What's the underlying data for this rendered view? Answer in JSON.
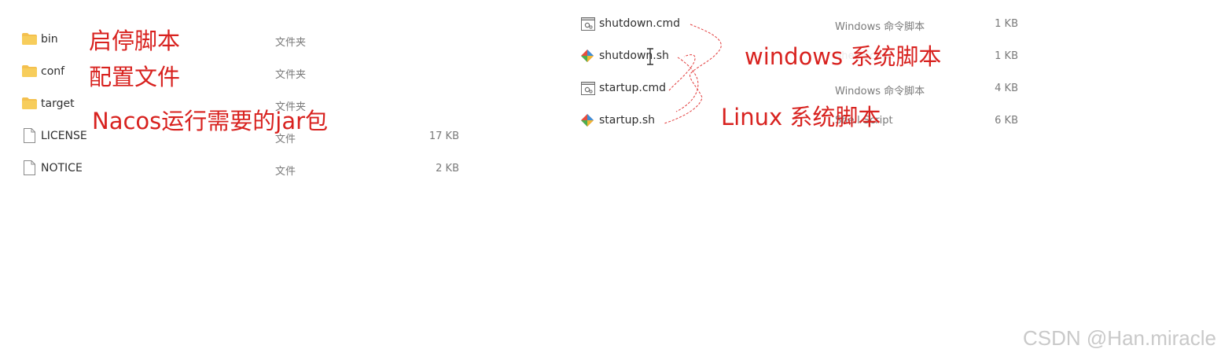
{
  "left_panel": {
    "files": [
      {
        "name": "bin",
        "type": "文件夹",
        "size": "",
        "icon": "folder-icon"
      },
      {
        "name": "conf",
        "type": "文件夹",
        "size": "",
        "icon": "folder-icon"
      },
      {
        "name": "target",
        "type": "文件夹",
        "size": "",
        "icon": "folder-icon"
      },
      {
        "name": "LICENSE",
        "type": "文件",
        "size": "17 KB",
        "icon": "file-icon"
      },
      {
        "name": "NOTICE",
        "type": "文件",
        "size": "2 KB",
        "icon": "file-icon"
      }
    ]
  },
  "right_panel": {
    "files": [
      {
        "name": "shutdown.cmd",
        "type": "Windows 命令脚本",
        "size": "1 KB",
        "icon": "cmd-script-icon"
      },
      {
        "name": "shutdown.sh",
        "type": "Shell Script",
        "size": "1 KB",
        "icon": "shell-script-icon"
      },
      {
        "name": "startup.cmd",
        "type": "Windows 命令脚本",
        "size": "4 KB",
        "icon": "cmd-script-icon"
      },
      {
        "name": "startup.sh",
        "type": "Shell Script",
        "size": "6 KB",
        "icon": "shell-script-icon"
      }
    ]
  },
  "annotations": {
    "bin": "启停脚本",
    "conf": "配置文件",
    "target": "Nacos运行需要的jar包",
    "windows": "windows 系统脚本",
    "linux": "Linux 系统脚本"
  },
  "colors": {
    "annotation": "#d8221f",
    "folder": "#f4c04e",
    "watermark": "#c9c9c9"
  },
  "watermark": "CSDN @Han.miracle"
}
